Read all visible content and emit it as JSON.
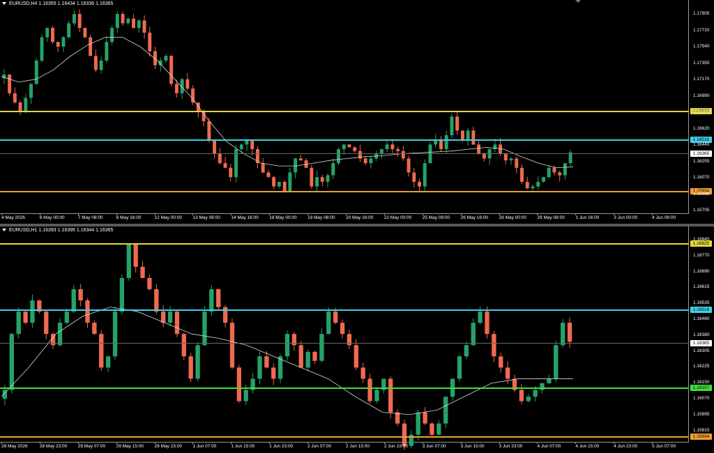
{
  "top_pane": {
    "title": "EURUSD,H4  1.16355 1.16434 1.16336 1.16365",
    "y_labels": [
      "1.17905",
      "1.17720",
      "1.17540",
      "1.17355",
      "1.17170",
      "1.16990",
      "1.16805",
      "1.16620",
      "1.16440",
      "1.16255",
      "1.16070",
      "1.15885",
      "1.15705"
    ],
    "x_labels": [
      "4 May 2026",
      "6 May 00:00",
      "7 May 08:00",
      "8 May 16:00",
      "12 May 00:00",
      "13 May 08:00",
      "14 May 16:00",
      "18 May 00:00",
      "19 May 08:00",
      "20 May 16:00",
      "22 May 00:00",
      "25 May 08:00",
      "26 May 16:00",
      "28 May 00:00",
      "29 May 08:00",
      "1 Jun 16:00",
      "3 Jun 00:00",
      "4 Jun 08:00"
    ],
    "levels": [
      {
        "label": "1.16825",
        "color": "#e6d83a",
        "kind": "yellow"
      },
      {
        "label": "1.16516",
        "color": "#3fd0e6",
        "kind": "cyan"
      },
      {
        "label": "1.16365",
        "color": "#c8c8c8",
        "kind": "current"
      },
      {
        "label": "1.15934",
        "color": "#f0a030",
        "kind": "orange"
      }
    ]
  },
  "bottom_pane": {
    "title": "EURUSD,H1  1.16393 1.16395 1.16344 1.16365",
    "y_labels": [
      "1.16845",
      "1.16770",
      "1.16690",
      "1.16615",
      "1.16535",
      "1.16460",
      "1.16380",
      "1.16305",
      "1.16225",
      "1.16150",
      "1.16070",
      "1.15995",
      "1.15915"
    ],
    "x_labels": [
      "28 May 2026",
      "28 May 23:00",
      "29 May 07:00",
      "29 May 15:00",
      "29 May 23:00",
      "1 Jun 07:00",
      "1 Jun 15:00",
      "1 Jun 23:00",
      "2 Jun 07:00",
      "2 Jun 15:00",
      "2 Jun 23:00",
      "3 Jun 07:00",
      "3 Jun 15:00",
      "3 Jun 23:00",
      "4 Jun 07:00",
      "4 Jun 15:00",
      "4 Jun 23:00",
      "5 Jun 07:00"
    ],
    "levels": [
      {
        "label": "1.16825",
        "color": "#e6d83a",
        "kind": "yellow"
      },
      {
        "label": "1.16516",
        "color": "#3fd0e6",
        "kind": "cyan"
      },
      {
        "label": "1.16365",
        "color": "#c8c8c8",
        "kind": "current"
      },
      {
        "label": "1.16157",
        "color": "#3ee03e",
        "kind": "green"
      },
      {
        "label": "1.15934",
        "color": "#f0a030",
        "kind": "orange"
      }
    ]
  },
  "colors": {
    "bull": "#26a269",
    "bear": "#ef6a4f",
    "ma": "#d8d8d8",
    "background": "#000000"
  },
  "chart_data": [
    {
      "type": "candlestick",
      "title": "EURUSD,H4",
      "ohlc_current": {
        "open": 1.16355,
        "high": 1.16434,
        "low": 1.16336,
        "close": 1.16365
      },
      "ylim": [
        1.15705,
        1.18
      ],
      "series": [
        {
          "name": "EURUSD,H4",
          "closes": [
            1.172,
            1.17,
            1.169,
            1.168,
            1.1695,
            1.171,
            1.1735,
            1.176,
            1.177,
            1.1755,
            1.175,
            1.176,
            1.1775,
            1.1785,
            1.177,
            1.176,
            1.174,
            1.1725,
            1.1735,
            1.1755,
            1.177,
            1.1785,
            1.1775,
            1.178,
            1.177,
            1.1778,
            1.1765,
            1.1745,
            1.173,
            1.1735,
            1.174,
            1.171,
            1.17,
            1.1715,
            1.1705,
            1.169,
            1.168,
            1.167,
            1.165,
            1.1635,
            1.1625,
            1.162,
            1.161,
            1.164,
            1.1645,
            1.165,
            1.164,
            1.1625,
            1.1615,
            1.161,
            1.16,
            1.1605,
            1.1595,
            1.1615,
            1.163,
            1.1628,
            1.162,
            1.16,
            1.161,
            1.1605,
            1.1612,
            1.1625,
            1.164,
            1.1645,
            1.1642,
            1.1638,
            1.163,
            1.1625,
            1.163,
            1.1635,
            1.164,
            1.1645,
            1.164,
            1.1638,
            1.163,
            1.1615,
            1.1605,
            1.16,
            1.1625,
            1.1645,
            1.165,
            1.164,
            1.1655,
            1.1675,
            1.166,
            1.165,
            1.166,
            1.1645,
            1.1635,
            1.163,
            1.164,
            1.1645,
            1.1635,
            1.1628,
            1.163,
            1.162,
            1.1605,
            1.1598,
            1.16,
            1.1605,
            1.161,
            1.162,
            1.1615,
            1.1612,
            1.1625,
            1.16365
          ]
        },
        {
          "name": "MA",
          "values": [
            1.1718,
            1.1712,
            1.1715,
            1.1725,
            1.174,
            1.1752,
            1.176,
            1.176,
            1.175,
            1.1735,
            1.1715,
            1.1695,
            1.167,
            1.1648,
            1.1635,
            1.1625,
            1.1622,
            1.1622,
            1.1625,
            1.1628,
            1.163,
            1.1632,
            1.1633,
            1.1635,
            1.1636,
            1.1637,
            1.1638,
            1.164,
            1.1642,
            1.164,
            1.1632,
            1.1625,
            1.162,
            1.1621
          ]
        }
      ]
    },
    {
      "type": "candlestick",
      "title": "EURUSD,H1",
      "ohlc_current": {
        "open": 1.16393,
        "high": 1.16395,
        "low": 1.16344,
        "close": 1.16365
      },
      "ylim": [
        1.15915,
        1.1688
      ],
      "series": [
        {
          "name": "EURUSD,H1",
          "closes": [
            1.1615,
            1.164,
            1.165,
            1.1645,
            1.1655,
            1.165,
            1.164,
            1.1635,
            1.1645,
            1.165,
            1.166,
            1.1655,
            1.1645,
            1.164,
            1.1625,
            1.163,
            1.165,
            1.1665,
            1.168,
            1.167,
            1.1665,
            1.166,
            1.165,
            1.1645,
            1.165,
            1.164,
            1.163,
            1.162,
            1.1635,
            1.165,
            1.166,
            1.1652,
            1.1645,
            1.1625,
            1.161,
            1.1615,
            1.162,
            1.163,
            1.1625,
            1.162,
            1.163,
            1.164,
            1.1635,
            1.1625,
            1.1632,
            1.1628,
            1.164,
            1.165,
            1.1645,
            1.164,
            1.1635,
            1.1625,
            1.162,
            1.161,
            1.1615,
            1.162,
            1.1605,
            1.16,
            1.159,
            1.1595,
            1.1605,
            1.16,
            1.1595,
            1.16,
            1.1612,
            1.162,
            1.163,
            1.1635,
            1.1645,
            1.165,
            1.164,
            1.163,
            1.1625,
            1.162,
            1.1615,
            1.161,
            1.1612,
            1.1615,
            1.1618,
            1.162,
            1.1635,
            1.1645,
            1.16365
          ]
        },
        {
          "name": "MA",
          "values": [
            1.1612,
            1.1625,
            1.164,
            1.1648,
            1.1652,
            1.165,
            1.1645,
            1.164,
            1.1638,
            1.1635,
            1.163,
            1.1625,
            1.162,
            1.1612,
            1.1605,
            1.1604,
            1.1606,
            1.1612,
            1.1618,
            1.162,
            1.162,
            1.162
          ]
        }
      ]
    }
  ]
}
